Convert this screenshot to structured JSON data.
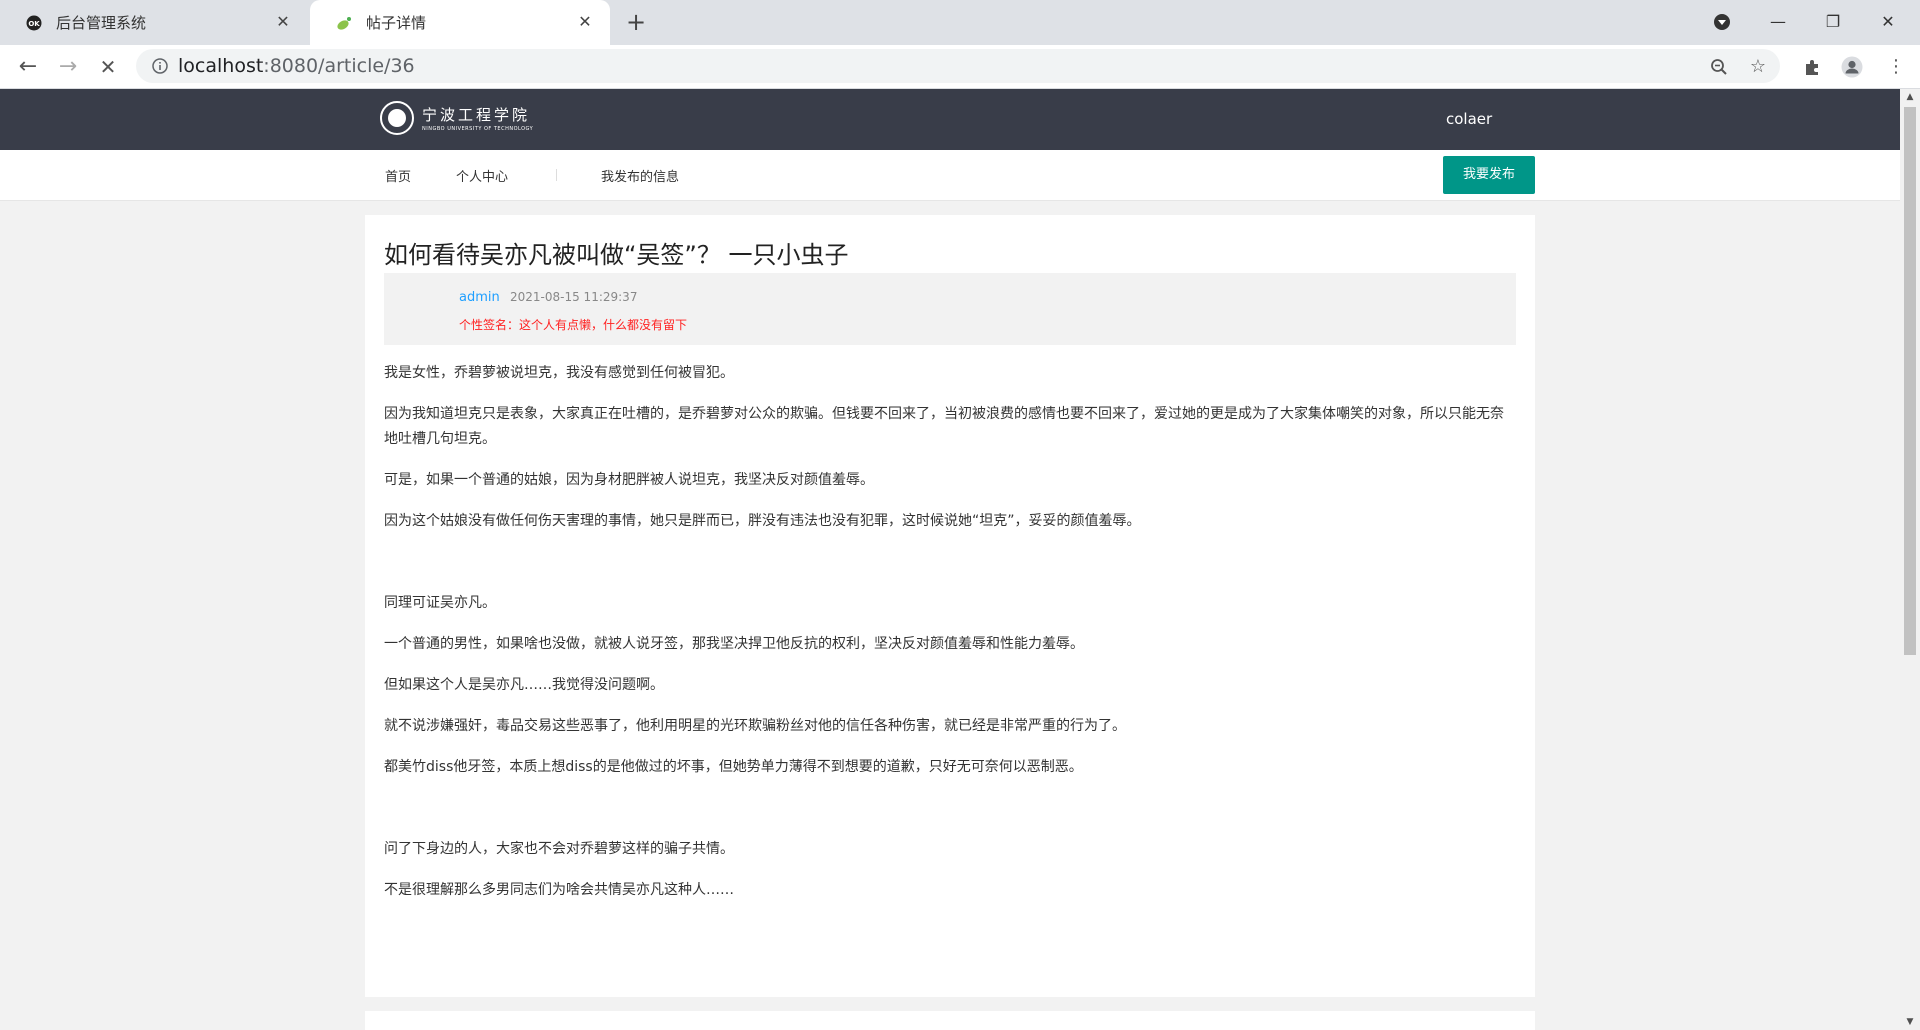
{
  "browser": {
    "tabs": [
      {
        "title": "后台管理系统",
        "favicon": "ok-icon"
      },
      {
        "title": "帖子详情",
        "favicon": "leaf-icon"
      }
    ],
    "url_host": "localhost",
    "url_path": ":8080/article/36"
  },
  "site": {
    "logo_cn": "宁波工程学院",
    "logo_en": "NINGBO UNIVERSITY OF TECHNOLOGY",
    "user": "colaer",
    "nav": {
      "home": "首页",
      "profile": "个人中心",
      "my_posts": "我发布的信息",
      "publish": "我要发布"
    },
    "accent": "#009688",
    "header_bg": "#393d49"
  },
  "article": {
    "title": "如何看待吴亦凡被叫做“吴签”？  一只小虫子",
    "author": "admin",
    "time": "2021-08-15 11:29:37",
    "signature": "个性签名：这个人有点懒，什么都没有留下",
    "paragraphs": [
      "我是女性，乔碧萝被说坦克，我没有感觉到任何被冒犯。",
      "因为我知道坦克只是表象，大家真正在吐槽的，是乔碧萝对公众的欺骗。但钱要不回来了，当初被浪费的感情也要不回来了，爱过她的更是成为了大家集体嘲笑的对象，所以只能无奈地吐槽几句坦克。",
      "可是，如果一个普通的姑娘，因为身材肥胖被人说坦克，我坚决反对颜值羞辱。",
      "因为这个姑娘没有做任何伤天害理的事情，她只是胖而已，胖没有违法也没有犯罪，这时候说她“坦克”，妥妥的颜值羞辱。",
      "",
      "同理可证吴亦凡。",
      "一个普通的男性，如果啥也没做，就被人说牙签，那我坚决捍卫他反抗的权利，坚决反对颜值羞辱和性能力羞辱。",
      "但如果这个人是吴亦凡……我觉得没问题啊。",
      "就不说涉嫌强奸，毒品交易这些恶事了，他利用明星的光环欺骗粉丝对他的信任各种伤害，就已经是非常严重的行为了。",
      "都美竹diss他牙签，本质上想diss的是他做过的坏事，但她势单力薄得不到想要的道歉，只好无可奈何以恶制恶。",
      "",
      "问了下身边的人，大家也不会对乔碧萝这样的骗子共情。",
      "不是很理解那么多男同志们为啥会共情吴亦凡这种人……"
    ]
  }
}
